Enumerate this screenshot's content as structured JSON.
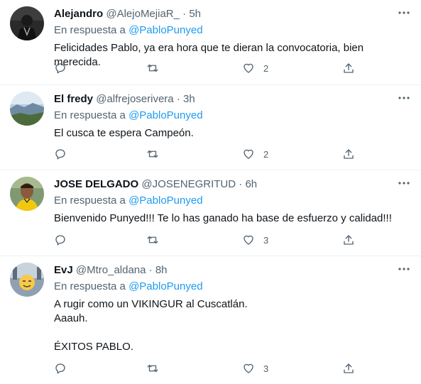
{
  "reply_prefix": "En respuesta a",
  "tweets": [
    {
      "name": "Alejandro",
      "handle": "@AlejoMejiaR_",
      "time": "5h",
      "mention": "@PabloPunyed",
      "lines": [
        "Felicidades Pablo, ya era hora que te dieran la convocatoria, bien merecida."
      ],
      "likes": "2"
    },
    {
      "name": "El fredy",
      "handle": "@alfrejoserivera",
      "time": "3h",
      "mention": "@PabloPunyed",
      "lines": [
        "El cusca te espera Campeón."
      ],
      "likes": "2"
    },
    {
      "name": "JOSE DELGADO",
      "handle": "@JOSENEGRITUD",
      "time": "6h",
      "mention": "@PabloPunyed",
      "lines": [
        "Bienvenido Punyed!!! Te lo has ganado ha base de esfuerzo y calidad!!!"
      ],
      "likes": "3"
    },
    {
      "name": "EvJ",
      "handle": "@Mtro_aldana",
      "time": "8h",
      "mention": "@PabloPunyed",
      "lines": [
        "A rugir como un VIKINGUR al Cuscatlán.",
        "Aaauh.",
        "",
        "ÉXITOS PABLO."
      ],
      "likes": "3"
    }
  ],
  "separator": "·",
  "colors": {
    "accent": "#1d9bf0",
    "secondary": "#536471",
    "text": "#0f1419"
  }
}
